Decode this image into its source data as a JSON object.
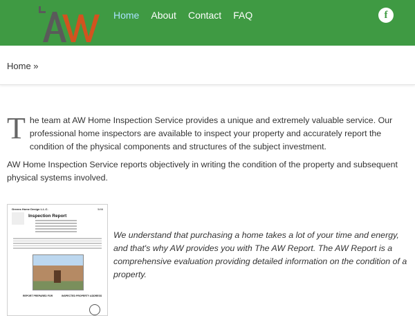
{
  "header": {
    "logo_text": "AW",
    "nav": [
      {
        "label": "Home",
        "active": true
      },
      {
        "label": "About",
        "active": false
      },
      {
        "label": "Contact",
        "active": false
      },
      {
        "label": "FAQ",
        "active": false
      }
    ],
    "social_icon": "facebook-icon",
    "social_glyph": "f"
  },
  "breadcrumb": {
    "text": "Home »"
  },
  "content": {
    "intro_dropcap": "T",
    "intro_rest": "he team at AW Home Inspection Service provides a unique and extremely valuable service. Our professional home inspectors are available to inspect your property and accurately report the condition of the physical components and structures of the subject investment.",
    "paragraph2": "AW Home Inspection Service reports objectively in writing the condition of the property and subsequent physical systems involved.",
    "quote": "We understand that purchasing a home takes a lot of your time and energy, and that's why AW provides you with The AW Report. The AW Report is a comprehensive evaluation providing detailed information on the condition of a property."
  },
  "report_image": {
    "company": "Greens Home Design L.L.C.",
    "page": "5/46",
    "title": "Inspection Report",
    "footer_left": "REPORT PREPARED FOR",
    "footer_right": "INSPECTED PROPERTY ADDRESS"
  },
  "colors": {
    "header_green": "#3f9a43",
    "nav_active": "#a9e3ff",
    "logo_dark": "#5a5a5a",
    "logo_orange": "#d2531f"
  }
}
